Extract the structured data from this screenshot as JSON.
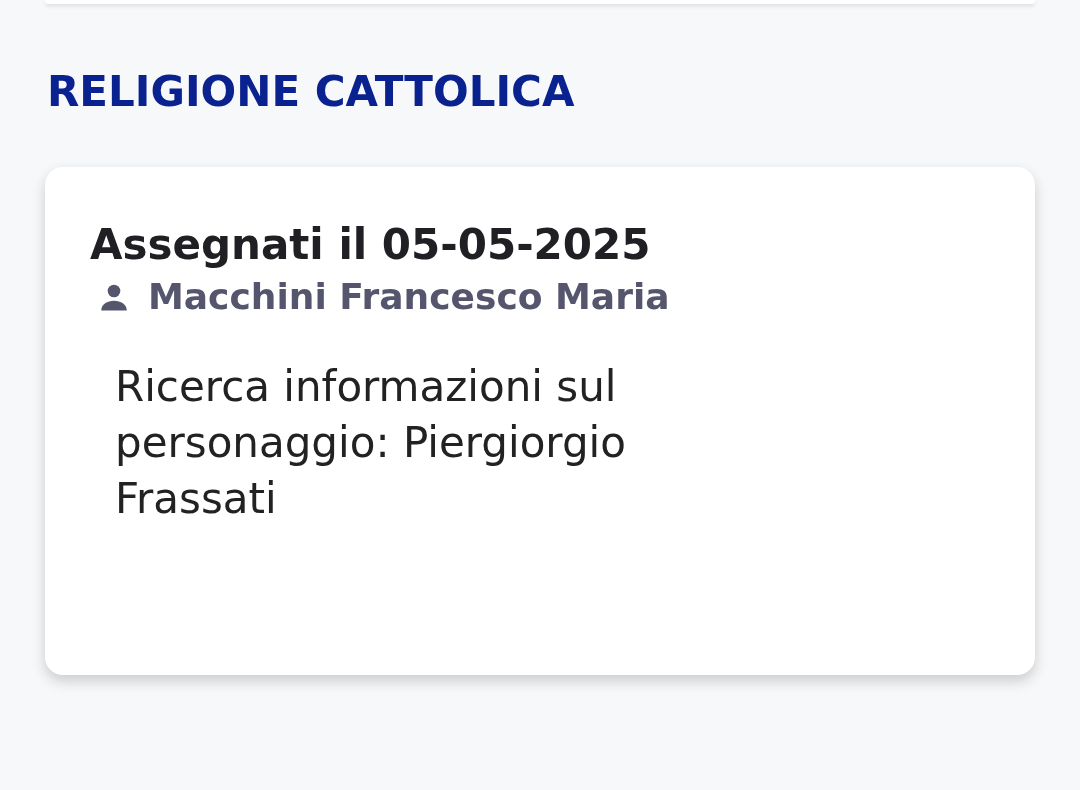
{
  "subject": "RELIGIONE CATTOLICA",
  "assignments": [
    {
      "title": "Assegnati il 05-05-2025",
      "teacher": "Macchini Francesco Maria",
      "description": "Ricerca informazioni sul personaggio: Piergiorgio Frassati"
    }
  ]
}
